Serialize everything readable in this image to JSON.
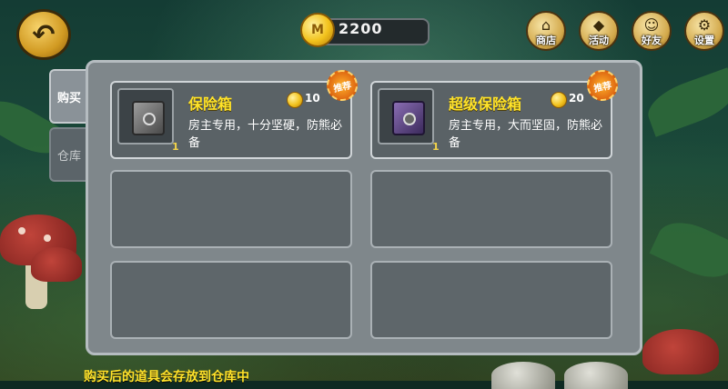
{
  "coins": {
    "amount": "2200",
    "symbol": "M"
  },
  "top_nav": [
    {
      "label": "商店",
      "icon": "shop-icon"
    },
    {
      "label": "活动",
      "icon": "event-icon"
    },
    {
      "label": "好友",
      "icon": "friends-icon"
    },
    {
      "label": "设置",
      "icon": "settings-icon"
    }
  ],
  "tabs": {
    "buy": "购买",
    "storage": "仓库"
  },
  "items": [
    {
      "name": "保险箱",
      "price": "10",
      "qty": "1",
      "desc": "房主专用，十分坚硬，防熊必备",
      "badge": "推荐"
    },
    {
      "name": "超级保险箱",
      "price": "20",
      "qty": "1",
      "desc": "房主专用，大而坚固，防熊必备",
      "badge": "推荐"
    }
  ],
  "hint": "购买后的道具会存放到仓库中"
}
